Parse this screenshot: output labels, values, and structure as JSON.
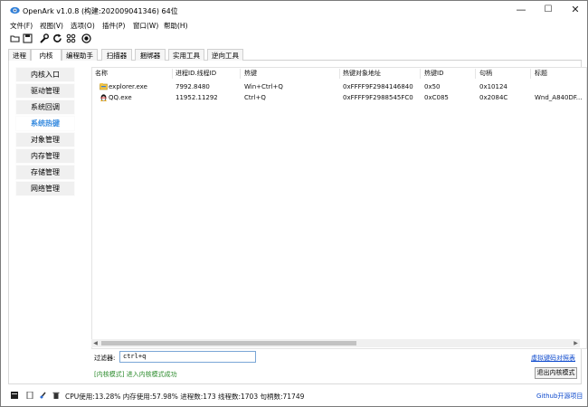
{
  "window": {
    "title": "OpenArk v1.0.8  (构建:202009041346)  64位",
    "minimize": "—",
    "maximize": "☐",
    "close": "✕",
    "icon": "openark-eye-icon"
  },
  "menu": {
    "items": [
      "文件(F)",
      "视图(V)",
      "选项(O)",
      "插件(P)",
      "窗口(W)",
      "帮助(H)"
    ]
  },
  "toolbar": {
    "icons": [
      "open-folder-icon",
      "save-icon",
      "wrench-icon",
      "refresh-icon",
      "grid-icon",
      "target-icon"
    ]
  },
  "tabs": [
    "进程",
    "内核",
    "编程助手",
    "扫描器",
    "捆绑器",
    "实用工具",
    "逆向工具"
  ],
  "active_tab": "内核",
  "sidebar": {
    "items": [
      "内核入口",
      "驱动管理",
      "系统回调",
      "系统热键",
      "对象管理",
      "内存管理",
      "存储管理",
      "网络管理"
    ],
    "active": "系统热键"
  },
  "hotkey_table": {
    "columns": [
      "名称",
      "进程ID.线程ID",
      "热键",
      "热键对象地址",
      "热键ID",
      "句柄",
      "标题"
    ],
    "rows": [
      {
        "icon": "explorer-folder-icon",
        "name": "explorer.exe",
        "pid_tid": "7992.8480",
        "hotkey": "Win+Ctrl+Q",
        "object": "0xFFFF9F2984146840",
        "hotkey_id": "0x50",
        "handle": "0x10124",
        "title": ""
      },
      {
        "icon": "qq-penguin-icon",
        "name": "QQ.exe",
        "pid_tid": "11952.11292",
        "hotkey": "Ctrl+Q",
        "object": "0xFFFF9F2988545FC0",
        "hotkey_id": "0xC085",
        "handle": "0x2084C",
        "title": "Wnd_A840DF..."
      }
    ]
  },
  "filter": {
    "label": "过滤器:",
    "value": "ctrl+q"
  },
  "links": {
    "virtual_hotkeys": "虚拟键码对照表"
  },
  "kernel_mode_status": "[内核模式] 进入内核模式成功",
  "exit_kernel_button": "退出内核模式",
  "status": {
    "text": "CPU使用:13.28%  内存使用:57.98%  进程数:173  线程数:1703  句柄数:71749",
    "github": "Github开源项目",
    "icons": [
      "console-icon",
      "document-icon",
      "brush-icon",
      "trash-icon"
    ]
  },
  "colors": {
    "active_side_text": "#3a8de0",
    "link": "#0a47cc",
    "success_text": "#2a8a2a"
  }
}
